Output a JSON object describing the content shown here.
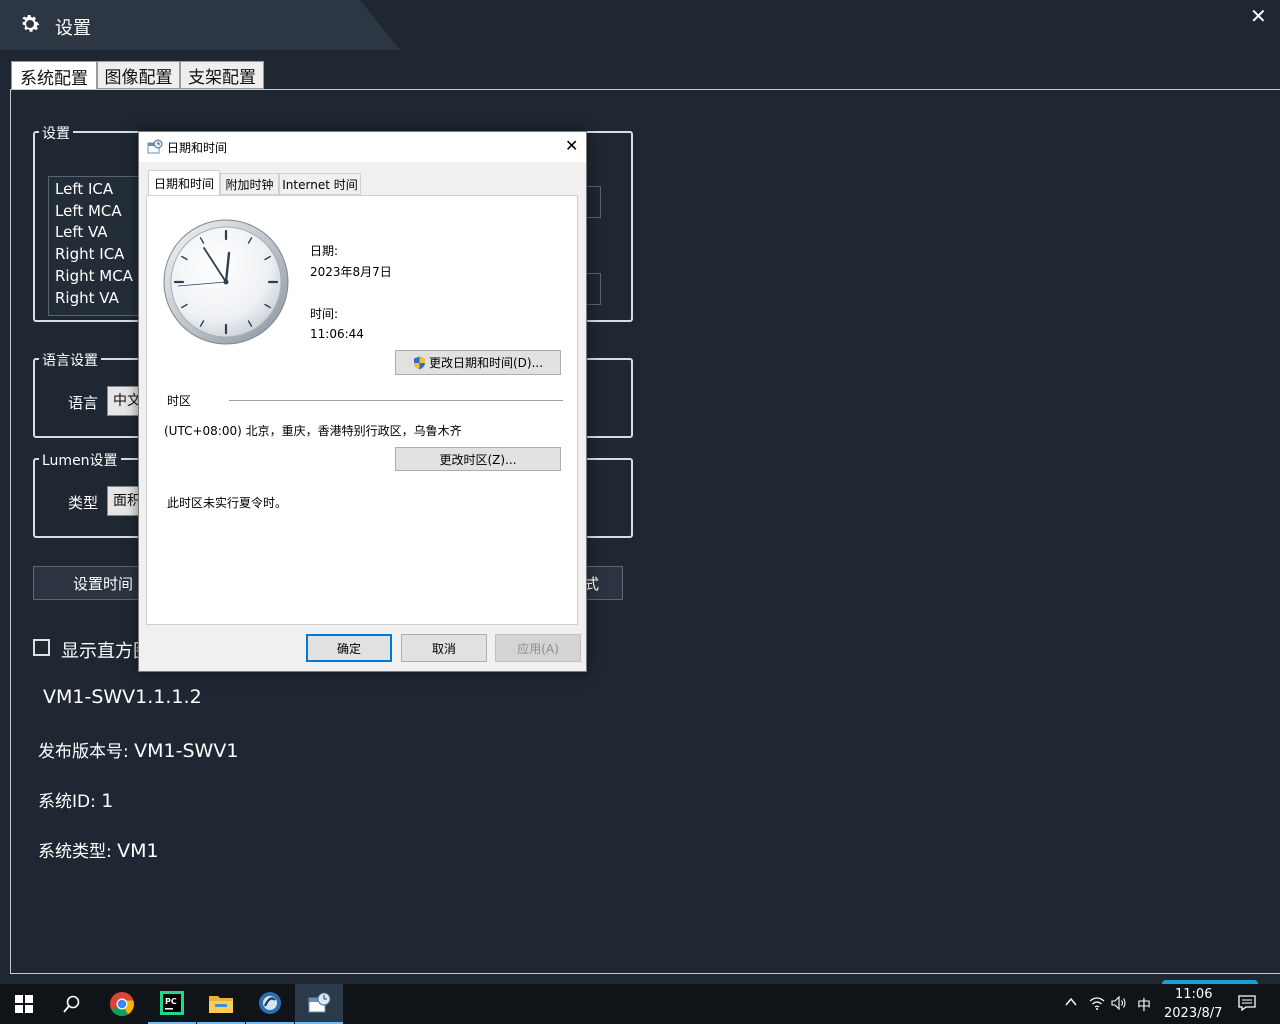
{
  "app": {
    "title": "设置",
    "close_symbol": "✕"
  },
  "tabs": [
    {
      "label": "系统配置",
      "active": true
    },
    {
      "label": "图像配置",
      "active": false
    },
    {
      "label": "支架配置",
      "active": false
    }
  ],
  "settings_group": {
    "legend": "设置",
    "list_items": [
      "Left ICA",
      "Left MCA",
      "Left VA",
      "Right ICA",
      "Right MCA",
      "Right VA"
    ]
  },
  "language_group": {
    "legend": "语言设置",
    "label": "语言",
    "value": "中文"
  },
  "lumen_group": {
    "legend": "Lumen设置",
    "label": "类型",
    "value": "面积"
  },
  "buttons": {
    "set_time": "设置时间",
    "right_fragment": "式"
  },
  "histogram_checkbox": {
    "label": "显示直方图",
    "checked": false
  },
  "info": {
    "version": "VM1-SWV1.1.1.2",
    "release_label": "发布版本号:",
    "release_value": "VM1-SWV1",
    "system_id_label": "系统ID:",
    "system_id_value": "1",
    "system_type_label": "系统类型:",
    "system_type_value": "VM1"
  },
  "dialog": {
    "title": "日期和时间",
    "close_symbol": "✕",
    "tabs": [
      "日期和时间",
      "附加时钟",
      "Internet 时间"
    ],
    "date_label": "日期:",
    "date_value": "2023年8月7日",
    "time_label": "时间:",
    "time_value": "11:06:44",
    "change_datetime_button": "更改日期和时间(D)...",
    "timezone_section": "时区",
    "timezone_value": "(UTC+08:00) 北京，重庆，香港特别行政区，乌鲁木齐",
    "change_timezone_button": "更改时区(Z)...",
    "dst_note": "此时区未实行夏令时。",
    "ok_button": "确定",
    "cancel_button": "取消",
    "apply_button": "应用(A)"
  },
  "taskbar": {
    "icons": [
      "windows-start-icon",
      "search-icon",
      "chrome-icon",
      "pycharm-icon",
      "file-explorer-icon",
      "app-icon",
      "date-time-settings-icon"
    ],
    "tray_ime": "中",
    "tray_time": "11:06",
    "tray_date": "2023/8/7"
  }
}
